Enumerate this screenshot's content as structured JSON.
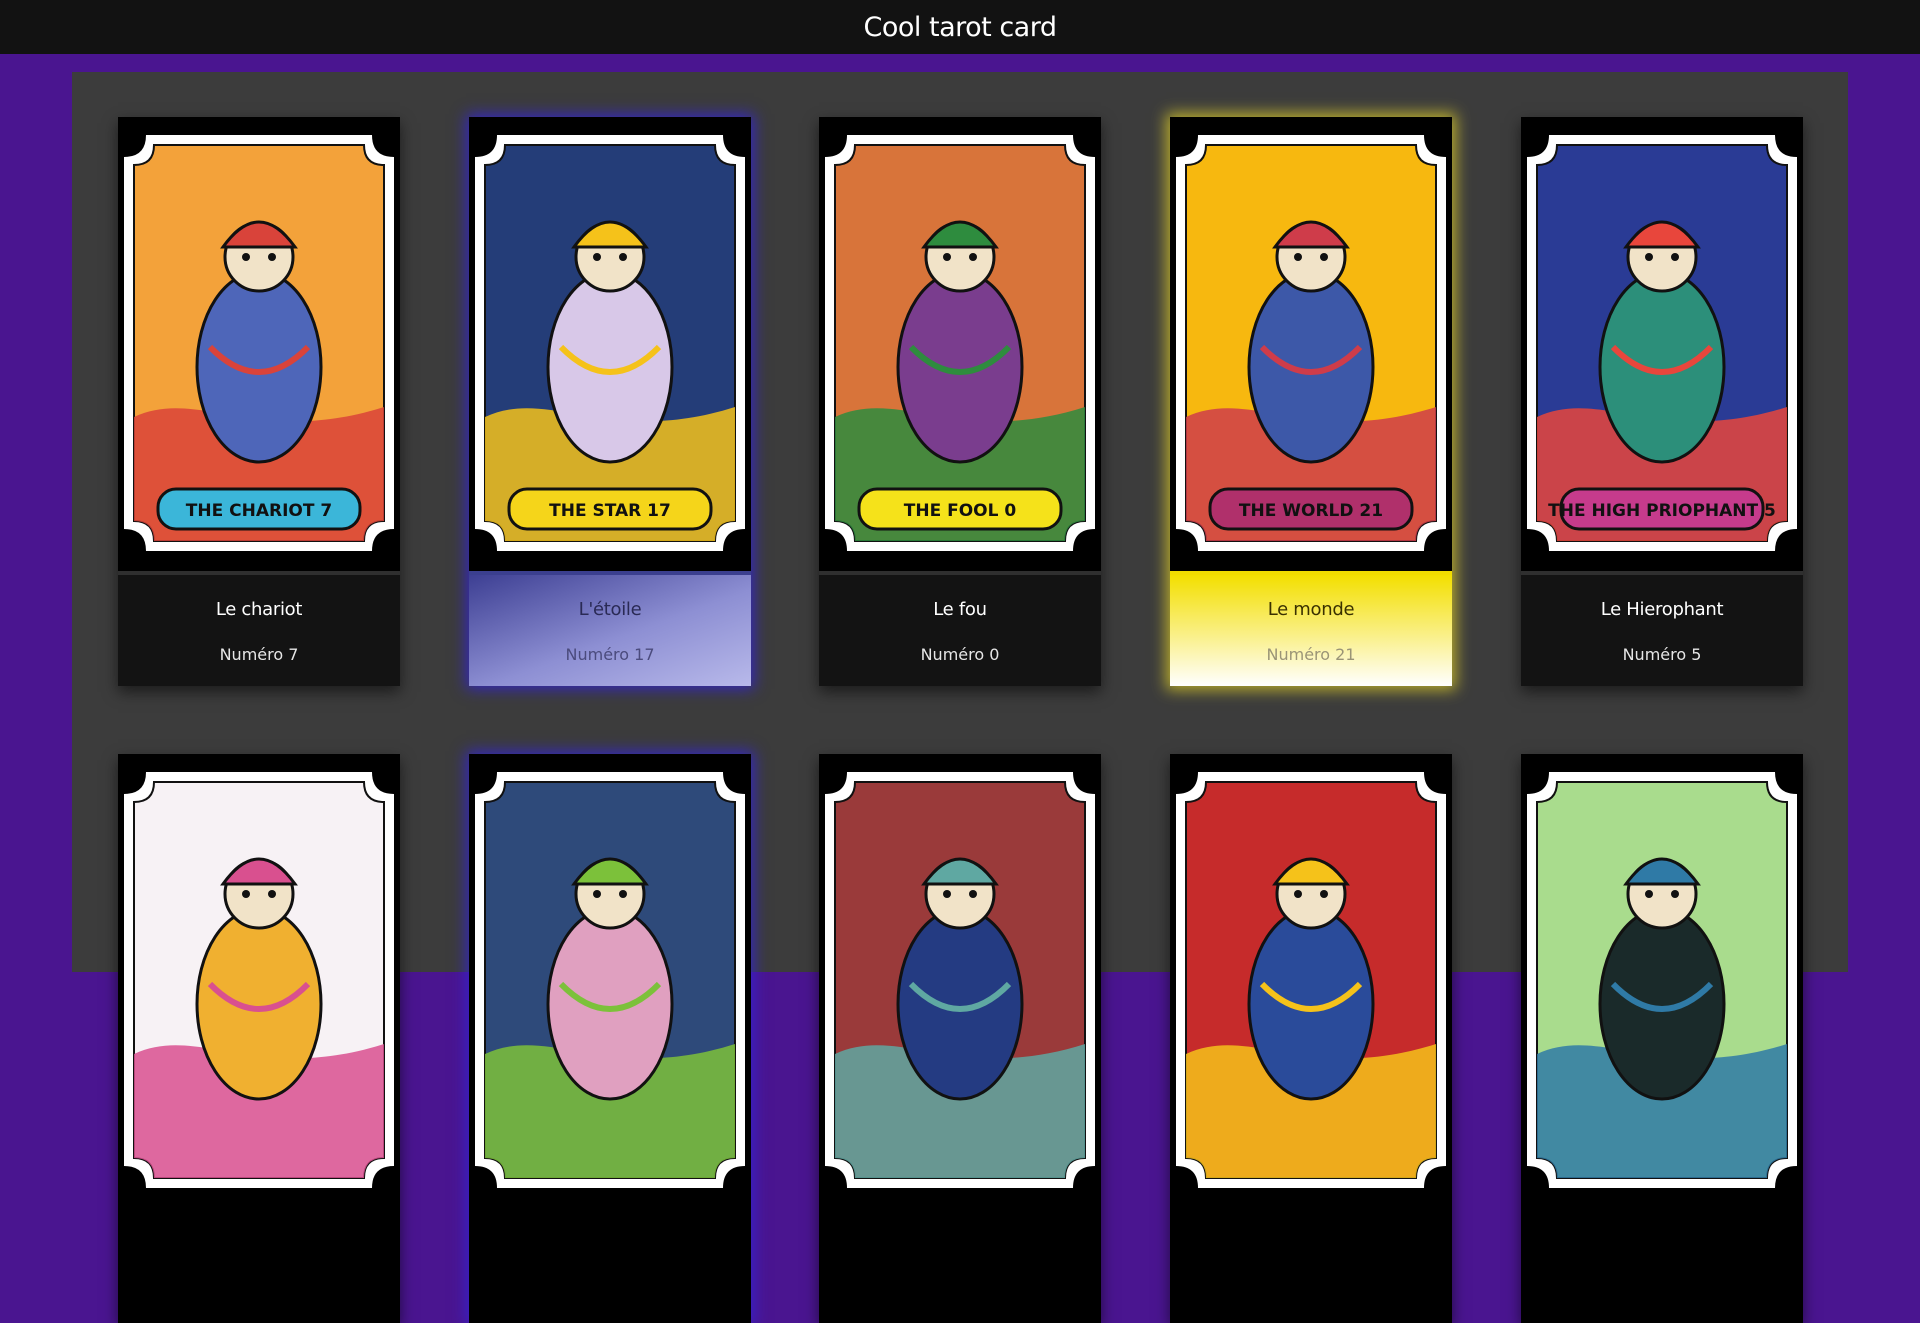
{
  "app": {
    "title": "Cool tarot card"
  },
  "colors": {
    "page_bg": "#4a1590",
    "topbar_bg": "#121212",
    "panel_bg": "#3c3c3c",
    "card_bg": "#000000",
    "caption_bg": "#131313",
    "star_accent": "#3323d2",
    "world_accent": "#e1d228"
  },
  "cards": [
    {
      "name": "Le chariot",
      "number": "Numéro 7",
      "banner": "THE CHARIOT",
      "banner_num": "7",
      "palette": {
        "bg": "#f3a23a",
        "accent": "#d9433a",
        "figure": "#4e66b9",
        "banner": "#3bb6d9"
      }
    },
    {
      "name": "L'étoile",
      "number": "Numéro 17",
      "banner": "THE STAR",
      "banner_num": "17",
      "palette": {
        "bg": "#243d78",
        "accent": "#f5c21a",
        "figure": "#d8c8e8",
        "banner": "#f5d51a"
      }
    },
    {
      "name": "Le fou",
      "number": "Numéro 0",
      "banner": "THE FOOL",
      "banner_num": "0",
      "palette": {
        "bg": "#d8743a",
        "accent": "#2e8c3e",
        "figure": "#7a3d8e",
        "banner": "#f5e21a"
      }
    },
    {
      "name": "Le monde",
      "number": "Numéro 21",
      "banner": "THE WORLD",
      "banner_num": "21",
      "palette": {
        "bg": "#f7b80f",
        "accent": "#cf3c4a",
        "figure": "#3d58a8",
        "banner": "#b0306b"
      }
    },
    {
      "name": "Le Hierophant",
      "number": "Numéro 5",
      "banner": "THE HIGH PRIOPHANT",
      "banner_num": "5",
      "palette": {
        "bg": "#2a3b95",
        "accent": "#e8463c",
        "figure": "#2c8f7a",
        "banner": "#c63b8c"
      }
    },
    {
      "name": "",
      "number": "",
      "banner": "",
      "banner_num": "",
      "palette": {
        "bg": "#f7f2f5",
        "accent": "#d9508f",
        "figure": "#f0b030",
        "banner": "#4aa3c3"
      }
    },
    {
      "name": "",
      "number": "",
      "banner": "",
      "banner_num": "",
      "palette": {
        "bg": "#2e4a7a",
        "accent": "#7cc13a",
        "figure": "#e0a0c0",
        "banner": "#5a3f86"
      }
    },
    {
      "name": "",
      "number": "",
      "banner": "",
      "banner_num": "",
      "palette": {
        "bg": "#9a3a3a",
        "accent": "#5fa8a2",
        "figure": "#243b82",
        "banner": "#d8d36a"
      }
    },
    {
      "name": "",
      "number": "",
      "banner": "",
      "banner_num": "",
      "palette": {
        "bg": "#c62b2b",
        "accent": "#f5c21a",
        "figure": "#2a4b9a",
        "banner": "#e8e8f5"
      }
    },
    {
      "name": "",
      "number": "",
      "banner": "",
      "banner_num": "",
      "palette": {
        "bg": "#a9dc8d",
        "accent": "#2f7aa6",
        "figure": "#1a2a2a",
        "banner": "#d94b3b"
      }
    }
  ]
}
